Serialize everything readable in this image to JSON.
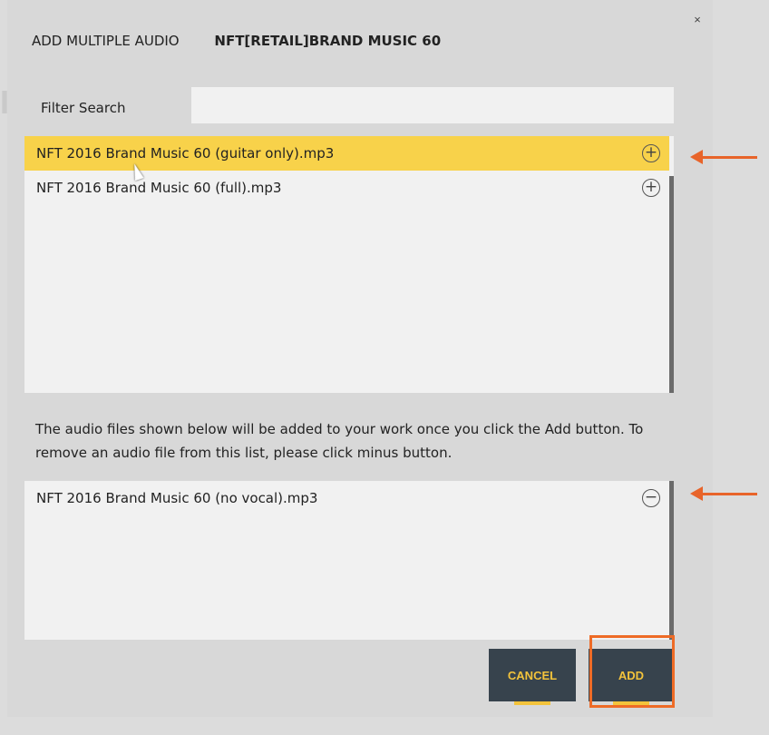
{
  "dialog": {
    "title": "ADD MULTIPLE AUDIO",
    "work_title": "NFT[RETAIL]BRAND MUSIC 60",
    "close_label": "×"
  },
  "filter": {
    "label": "Filter Search",
    "value": "",
    "placeholder": ""
  },
  "available_files": [
    {
      "name": "NFT 2016 Brand Music 60 (guitar only).mp3",
      "action": "+"
    },
    {
      "name": "NFT 2016 Brand Music 60 (full).mp3",
      "action": "+"
    }
  ],
  "instructions": "The audio files shown below will be added to your work once you click the Add button. To remove an audio file from this list, please click minus button.",
  "selected_files": [
    {
      "name": "NFT 2016 Brand Music 60 (no vocal).mp3",
      "action": "−"
    }
  ],
  "buttons": {
    "cancel": "CANCEL",
    "add": "ADD"
  },
  "colors": {
    "highlight_row": "#f8d24a",
    "button_bg": "#37434d",
    "button_text": "#f3c33b",
    "annotation": "#e8642a"
  }
}
